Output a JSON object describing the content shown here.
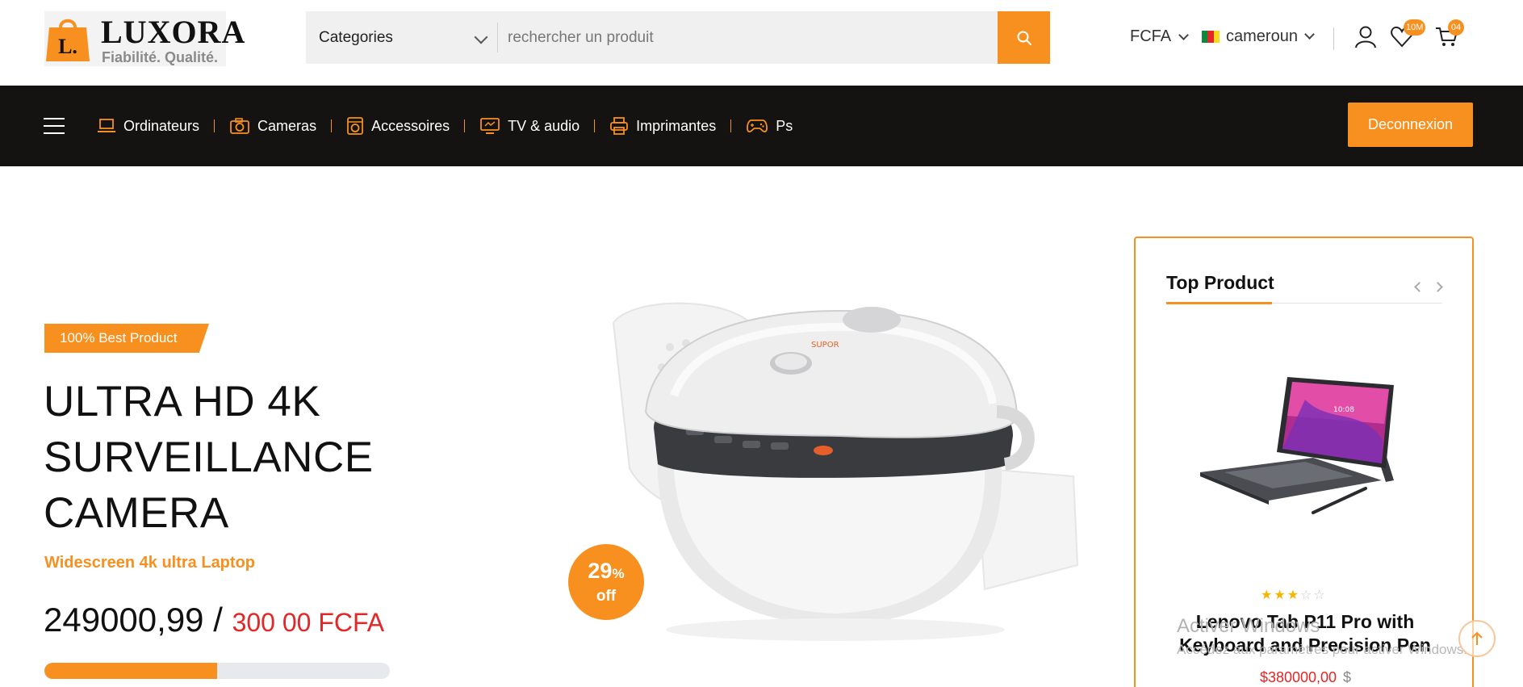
{
  "brand": {
    "logo_letter": "L.",
    "name": "LUXORA",
    "tagline": "Fiabilité. Qualité."
  },
  "search": {
    "category_label": "Categories",
    "placeholder": "rechercher un produit"
  },
  "header": {
    "currency": "FCFA",
    "country": "cameroun",
    "wishlist_count": "10M",
    "cart_count": "04"
  },
  "nav": {
    "items": [
      {
        "label": "Ordinateurs",
        "icon": "laptop-icon"
      },
      {
        "label": "Cameras",
        "icon": "camera-icon"
      },
      {
        "label": "Accessoires",
        "icon": "washing-machine-icon"
      },
      {
        "label": "TV & audio",
        "icon": "tv-icon"
      },
      {
        "label": "Imprimantes",
        "icon": "printer-icon"
      },
      {
        "label": "Ps",
        "icon": "gamepad-icon"
      }
    ],
    "logout_label": "Deconnexion"
  },
  "hero": {
    "badge": "100% Best Product",
    "title_lines": [
      "ULTRA HD 4K",
      "SURVEILLANCE",
      "CAMERA"
    ],
    "subtitle": "Widescreen 4k ultra Laptop",
    "price": "249000,99",
    "price_sep": " / ",
    "old_price": "300 00 FCFA",
    "progress": 0.5,
    "discount_number": "29",
    "discount_percent": "%",
    "discount_label": "off",
    "image": "rice-cooker"
  },
  "top_product": {
    "title": "Top Product",
    "product_name": "Lenovo Tab P11 Pro with Keyboard and Precision Pen",
    "rating": 3,
    "rating_max": 5,
    "price": "$380000,00",
    "currency": "$",
    "image": "tablet-with-keyboard"
  },
  "overlay": {
    "watermark_title": "Activer Windows",
    "watermark_sub": "Accédez aux paramètres pour activer Windows."
  },
  "colors": {
    "accent": "#f7901e",
    "nav_bg": "#141311",
    "price_red": "#e32626"
  }
}
